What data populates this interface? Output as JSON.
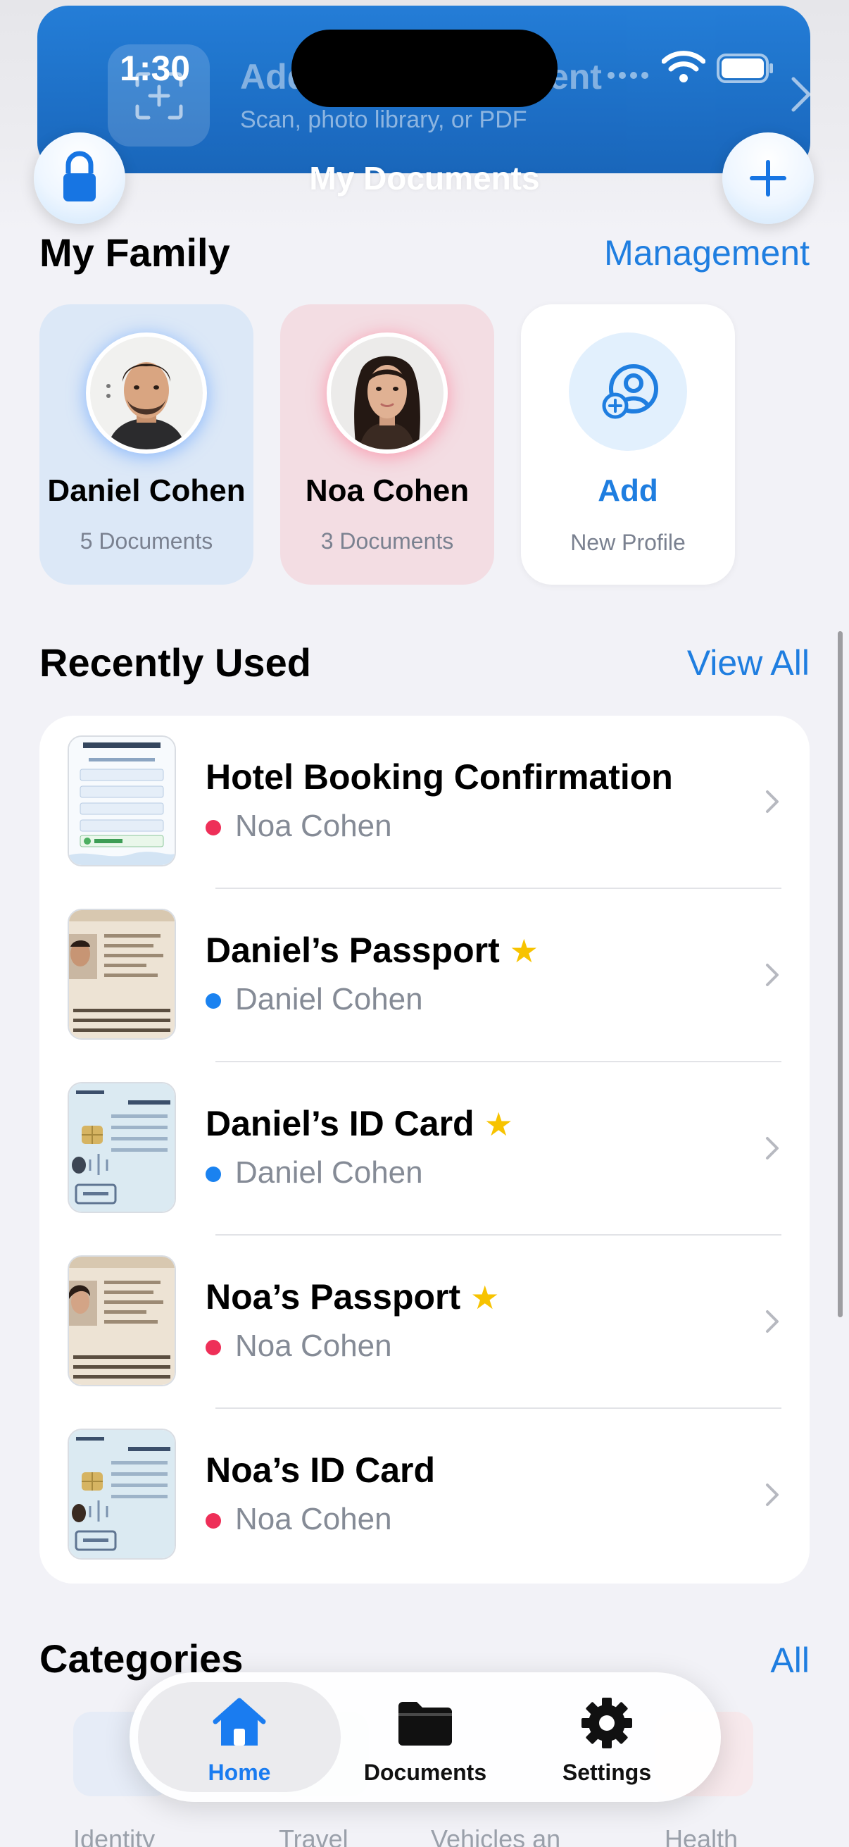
{
  "status_bar": {
    "time": "1:30"
  },
  "banner": {
    "title": "Add a New Document",
    "subtitle": "Scan, photo library, or PDF"
  },
  "nav": {
    "title": "My Documents"
  },
  "family": {
    "title": "My Family",
    "link": "Management",
    "profiles": [
      {
        "name": "Daniel Cohen",
        "count": "5 Documents",
        "color": "#dce8f7"
      },
      {
        "name": "Noa Cohen",
        "count": "3 Documents",
        "color": "#f3dde3"
      }
    ],
    "add": {
      "label": "Add",
      "sub": "New Profile"
    }
  },
  "recent": {
    "title": "Recently Used",
    "link": "View All",
    "items": [
      {
        "title": "Hotel Booking Confirmation",
        "owner": "Noa Cohen",
        "owner_color": "#ee2f58",
        "starred": false
      },
      {
        "title": "Daniel’s Passport",
        "owner": "Daniel Cohen",
        "owner_color": "#1a82f0",
        "starred": true
      },
      {
        "title": "Daniel’s ID Card",
        "owner": "Daniel Cohen",
        "owner_color": "#1a82f0",
        "starred": true
      },
      {
        "title": "Noa’s Passport",
        "owner": "Noa Cohen",
        "owner_color": "#ee2f58",
        "starred": true
      },
      {
        "title": "Noa’s ID Card",
        "owner": "Noa Cohen",
        "owner_color": "#ee2f58",
        "starred": false
      }
    ],
    "star_glyph": "★"
  },
  "categories": {
    "title": "Categories",
    "link": "All",
    "items": [
      {
        "label": "Identity"
      },
      {
        "label": "Travel"
      },
      {
        "label": "Vehicles an"
      },
      {
        "label": "Health"
      }
    ]
  },
  "tabs": [
    {
      "label": "Home",
      "icon": "house-icon",
      "active": true
    },
    {
      "label": "Documents",
      "icon": "folder-icon",
      "active": false
    },
    {
      "label": "Settings",
      "icon": "gear-icon",
      "active": false
    }
  ],
  "colors": {
    "accent": "#1f7ee0",
    "daniel": "#1a82f0",
    "noa": "#ee2f58",
    "star": "#f7c300",
    "banner": "#1a78d6"
  }
}
